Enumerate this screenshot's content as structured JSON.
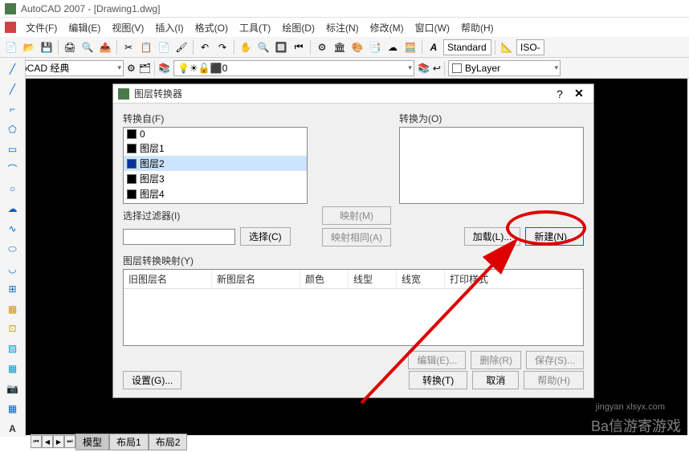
{
  "app": {
    "title": "AutoCAD 2007 - [Drawing1.dwg]"
  },
  "menu": {
    "items": [
      "文件(F)",
      "编辑(E)",
      "视图(V)",
      "插入(I)",
      "格式(O)",
      "工具(T)",
      "绘图(D)",
      "标注(N)",
      "修改(M)",
      "窗口(W)",
      "帮助(H)"
    ]
  },
  "toolbar": {
    "style_combo": "Standard",
    "iso_combo": "ISO-"
  },
  "toolbar2": {
    "workspace": "AutoCAD 经典",
    "layer": "0",
    "bylayer": "ByLayer"
  },
  "dialog": {
    "title": "图层转换器",
    "from_label": "转换自(F)",
    "to_label": "转换为(O)",
    "from_items": [
      "0",
      "图层1",
      "图层2",
      "图层3",
      "图层4"
    ],
    "filter_label": "选择过滤器(I)",
    "select_btn": "选择(C)",
    "map_btn": "映射(M)",
    "map_same_btn": "映射相同(A)",
    "load_btn": "加载(L)...",
    "new_btn": "新建(N)...",
    "mapping_label": "图层转换映射(Y)",
    "columns": {
      "old": "旧图层名",
      "new": "新图层名",
      "color": "颜色",
      "linetype": "线型",
      "lineweight": "线宽",
      "plotstyle": "打印样式"
    },
    "edit_btn": "编辑(E)...",
    "delete_btn": "删除(R)",
    "save_btn": "保存(S)...",
    "settings_btn": "设置(G)...",
    "convert_btn": "转换(T)",
    "cancel_btn": "取消",
    "help_btn": "帮助(H)"
  },
  "tabs": {
    "model": "模型",
    "layout1": "布局1",
    "layout2": "布局2"
  },
  "watermark": {
    "main": "Ba信游寄游戏",
    "sub": "jingyan xlsyx.com"
  }
}
